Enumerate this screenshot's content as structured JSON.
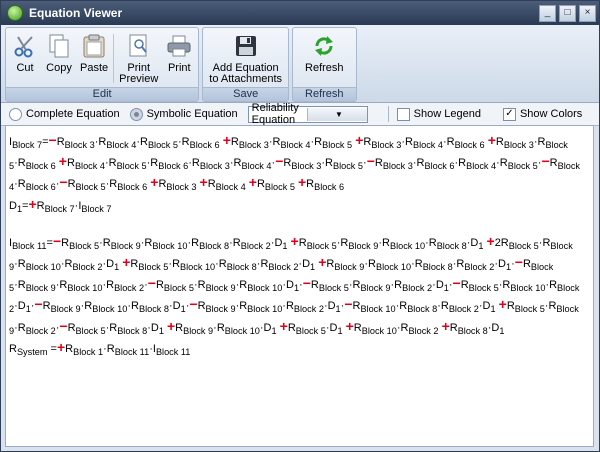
{
  "window": {
    "title": "Equation Viewer",
    "controls": {
      "minimize": "_",
      "maximize": "□",
      "close": "×"
    }
  },
  "ribbon": {
    "groups": [
      {
        "label": "Edit",
        "buttons": [
          {
            "label": "Cut",
            "icon": "scissors-icon"
          },
          {
            "label": "Copy",
            "icon": "copy-icon"
          },
          {
            "label": "Paste",
            "icon": "paste-icon"
          },
          {
            "label": "Print\nPreview",
            "icon": "print-preview-icon"
          },
          {
            "label": "Print",
            "icon": "printer-icon"
          }
        ]
      },
      {
        "label": "Save",
        "buttons": [
          {
            "label": "Add Equation\nto Attachments",
            "icon": "floppy-disk-icon"
          }
        ]
      },
      {
        "label": "Refresh",
        "buttons": [
          {
            "label": "Refresh",
            "icon": "refresh-icon"
          }
        ]
      }
    ]
  },
  "options": {
    "complete_label": "Complete Equation",
    "symbolic_label": "Symbolic Equation",
    "selected_mode": "symbolic",
    "equation_type": "Reliability Equation",
    "legend_label": "Show Legend",
    "legend_checked": false,
    "colors_label": "Show Colors",
    "colors_checked": true
  },
  "equations": [
    "I<sub>Block 7</sub>=<b class=r>−</b>R<sub>Block 3</sub>·R<sub>Block 4</sub>·R<sub>Block 5</sub>·R<sub>Block 6</sub> <b class=r>+</b>R<sub>Block 3</sub>·R<sub>Block 4</sub>·R<sub>Block 5</sub> <b class=r>+</b>R<sub>Block 3</sub>·R<sub>Block 4</sub>·R<sub>Block 6</sub> <b class=r>+</b>R<sub>Block 3</sub>·R<sub>Block 5</sub>·R<sub>Block 6</sub> <b class=r>+</b>R<sub>Block 4</sub>·R<sub>Block 5</sub>·R<sub>Block 6</sub>·R<sub>Block 3</sub>·R<sub>Block 4</sub>·<b class=r>−</b>R<sub>Block 3</sub>·R<sub>Block 5</sub>·<b class=r>−</b>R<sub>Block 3</sub>·R<sub>Block 6</sub>·R<sub>Block 4</sub>·R<sub>Block 5</sub>·<b class=r>−</b>R<sub>Block 4</sub>·R<sub>Block 6</sub>·<b class=r>−</b>R<sub>Block 5</sub>·R<sub>Block 6</sub> <b class=r>+</b>R<sub>Block 3</sub> <b class=r>+</b>R<sub>Block 4</sub> <b class=r>+</b>R<sub>Block 5</sub> <b class=r>+</b>R<sub>Block 6</sub>",
    "D<sub>1</sub>=<b class=r>+</b>R<sub>Block 7</sub>·I<sub>Block 7</sub>",
    "",
    "I<sub>Block 11</sub>=<b class=r>−</b>R<sub>Block 5</sub>·R<sub>Block 9</sub>·R<sub>Block 10</sub>·R<sub>Block 8</sub>·R<sub>Block 2</sub>·D<sub>1</sub> <b class=r>+</b>R<sub>Block 5</sub>·R<sub>Block 9</sub>·R<sub>Block 10</sub>·R<sub>Block 8</sub>·D<sub>1</sub> <b class=r>+</b>2R<sub>Block 5</sub>·R<sub>Block 9</sub>·R<sub>Block 10</sub>·R<sub>Block 2</sub>·D<sub>1</sub> <b class=r>+</b>R<sub>Block 5</sub>·R<sub>Block 10</sub>·R<sub>Block 8</sub>·R<sub>Block 2</sub>·D<sub>1</sub> <b class=r>+</b>R<sub>Block 9</sub>·R<sub>Block 10</sub>·R<sub>Block 8</sub>·R<sub>Block 2</sub>·D<sub>1</sub>·<b class=r>−</b>R<sub>Block 5</sub>·R<sub>Block 9</sub>·R<sub>Block 10</sub>·R<sub>Block 2</sub>·<b class=r>−</b>R<sub>Block 5</sub>·R<sub>Block 9</sub>·R<sub>Block 10</sub>·D<sub>1</sub>·<b class=r>−</b>R<sub>Block 5</sub>·R<sub>Block 9</sub>·R<sub>Block 2</sub>·D<sub>1</sub>·<b class=r>−</b>R<sub>Block 5</sub>·R<sub>Block 10</sub>·R<sub>Block 2</sub>·D<sub>1</sub>·<b class=r>−</b>R<sub>Block 9</sub>·R<sub>Block 10</sub>·R<sub>Block 8</sub>·D<sub>1</sub>·<b class=r>−</b>R<sub>Block 9</sub>·R<sub>Block 10</sub>·R<sub>Block 2</sub>·D<sub>1</sub>·<b class=r>−</b>R<sub>Block 10</sub>·R<sub>Block 8</sub>·R<sub>Block 2</sub>·D<sub>1</sub> <b class=r>+</b>R<sub>Block 5</sub>·R<sub>Block 9</sub>·R<sub>Block 2</sub>·<b class=r>−</b>R<sub>Block 5</sub>·R<sub>Block 8</sub>·D<sub>1</sub> <b class=r>+</b>R<sub>Block 9</sub>·R<sub>Block 10</sub>·D<sub>1</sub> <b class=r>+</b>R<sub>Block 5</sub>·D<sub>1</sub> <b class=r>+</b>R<sub>Block 10</sub>·R<sub>Block 2</sub> <b class=r>+</b>R<sub>Block 8</sub>·D<sub>1</sub>",
    "R<sub>System</sub> =<b class=r>+</b>R<sub>Block 1</sub>·R<sub>Block 11</sub>·I<sub>Block 11</sub>"
  ]
}
